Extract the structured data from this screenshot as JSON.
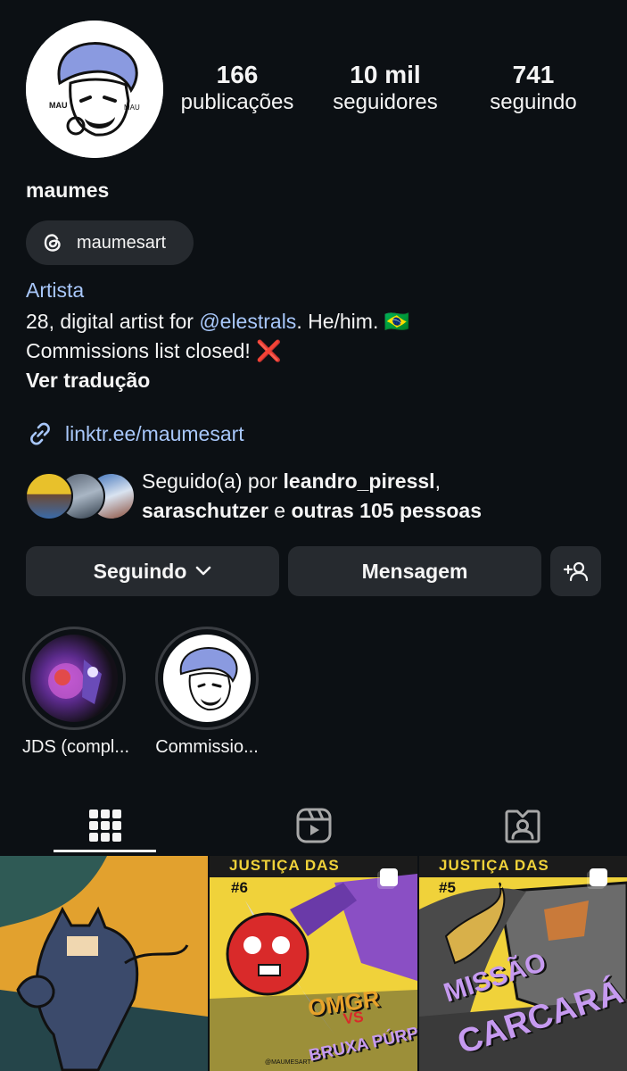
{
  "profile": {
    "username": "maumes",
    "stats": {
      "posts_count": "166",
      "posts_label": "publicações",
      "followers_count": "10 mil",
      "followers_label": "seguidores",
      "following_count": "741",
      "following_label": "seguindo"
    },
    "threads_handle": "maumesart",
    "category": "Artista",
    "bio": {
      "line1_prefix": "28, digital artist for ",
      "line1_mention": "@elestrals",
      "line1_suffix": ". He/him. ",
      "line1_flag": "🇧🇷",
      "line2": "Commissions list closed! ",
      "line2_emoji": "❌",
      "translate": "Ver tradução"
    },
    "link": "linktr.ee/maumesart",
    "followed_by": {
      "prefix": "Seguido(a) por ",
      "user1": "leandro_piressl",
      "sep": ",",
      "user2": "saraschutzer",
      "conj": " e ",
      "others": "outras 105 pessoas"
    }
  },
  "actions": {
    "following_label": "Seguindo",
    "message_label": "Mensagem"
  },
  "highlights": [
    {
      "label": "JDS (compl..."
    },
    {
      "label": "Commissio..."
    }
  ],
  "tabs": [
    {
      "icon": "grid-icon",
      "active": true
    },
    {
      "icon": "reels-icon",
      "active": false
    },
    {
      "icon": "tagged-icon",
      "active": false
    }
  ],
  "posts": [
    {
      "alt": "Batman illustration"
    },
    {
      "title": "JUSTIÇA DAS SOMBRAS",
      "issue": "#6",
      "subtitle": "VS",
      "line_a": "OMGR",
      "line_b": "BRUXA PÚRPURA!",
      "credit": "@MAUMESART"
    },
    {
      "title": "JUSTIÇA DAS SOMBRAS",
      "issue": "#5",
      "line_a": "MISSÃO",
      "line_b": "CARCARÁ"
    }
  ],
  "colors": {
    "background": "#0c1014",
    "button": "#262a2f",
    "link": "#a8c7fa"
  }
}
